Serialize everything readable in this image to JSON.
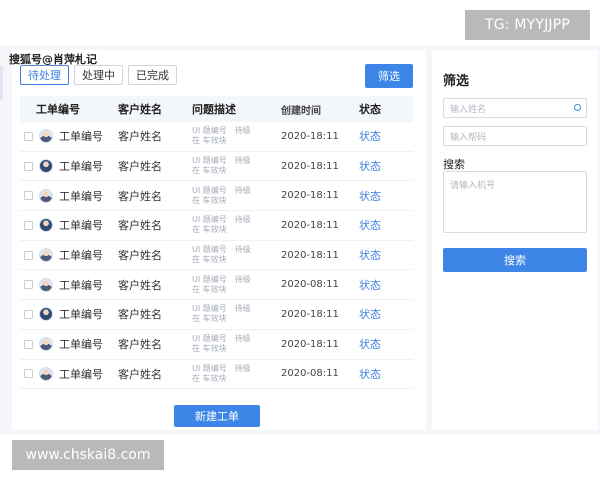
{
  "watermarks": {
    "tg": "TG: MYYJJPP",
    "url": "www.chskai8.com",
    "sohu": "搜狐号@肖萍札记"
  },
  "tabs": [
    {
      "label": "待处理",
      "active": true
    },
    {
      "label": "处理中",
      "active": false
    },
    {
      "label": "已完成",
      "active": false
    }
  ],
  "toolbar": {
    "filter_label": "筛选"
  },
  "table": {
    "headers": {
      "id": "工单编号",
      "name": "客户姓名",
      "desc": "问题描述",
      "time": "创建时间",
      "status": "状态"
    },
    "rows": [
      {
        "id": "工单编号",
        "name": "客户姓名",
        "desc1": "UI 题编号　待级",
        "desc2": "在 车效块",
        "time": "2020-18:11",
        "status": "状态",
        "avatar": "light"
      },
      {
        "id": "工单编号",
        "name": "客户姓名",
        "desc1": "UI 题编号　待级",
        "desc2": "在 车效块",
        "time": "2020-18:11",
        "status": "状态",
        "avatar": "dark"
      },
      {
        "id": "工单编号",
        "name": "客户姓名",
        "desc1": "UI 题编号　待级",
        "desc2": "在 车效块",
        "time": "2020-18:11",
        "status": "状态",
        "avatar": "light"
      },
      {
        "id": "工单编号",
        "name": "客户姓名",
        "desc1": "UI 题编号　待级",
        "desc2": "在 车效块",
        "time": "2020-18:11",
        "status": "状态",
        "avatar": "dark"
      },
      {
        "id": "工单编号",
        "name": "客户姓名",
        "desc1": "UI 题编号　待级",
        "desc2": "在 车效块",
        "time": "2020-18:11",
        "status": "状态",
        "avatar": "light"
      },
      {
        "id": "工单编号",
        "name": "客户姓名",
        "desc1": "UI 题编号　待级",
        "desc2": "在 车效块",
        "time": "2020-08:11",
        "status": "状态",
        "avatar": "light"
      },
      {
        "id": "工单编号",
        "name": "客户姓名",
        "desc1": "UI 题编号　待级",
        "desc2": "在 车效块",
        "time": "2020-18:11",
        "status": "状态",
        "avatar": "dark"
      },
      {
        "id": "工单编号",
        "name": "客户姓名",
        "desc1": "UI 题编号　待级",
        "desc2": "在 车效块",
        "time": "2020-18:11",
        "status": "状态",
        "avatar": "light"
      },
      {
        "id": "工单编号",
        "name": "客户姓名",
        "desc1": "UI 题编号　待级",
        "desc2": "在 车效块",
        "time": "2020-08:11",
        "status": "状态",
        "avatar": "light"
      }
    ],
    "new_ticket_label": "新建工单"
  },
  "filter_panel": {
    "title": "筛选",
    "name_placeholder": "输入姓名",
    "phone_placeholder": "输入帮码",
    "search_label": "搜索",
    "machine_placeholder": "请输入机号",
    "search_button": "搜索"
  },
  "colors": {
    "accent": "#3d86e8",
    "link": "#3d7fe0",
    "background": "#f4f6fa"
  },
  "icons": {
    "search": "search-icon"
  }
}
